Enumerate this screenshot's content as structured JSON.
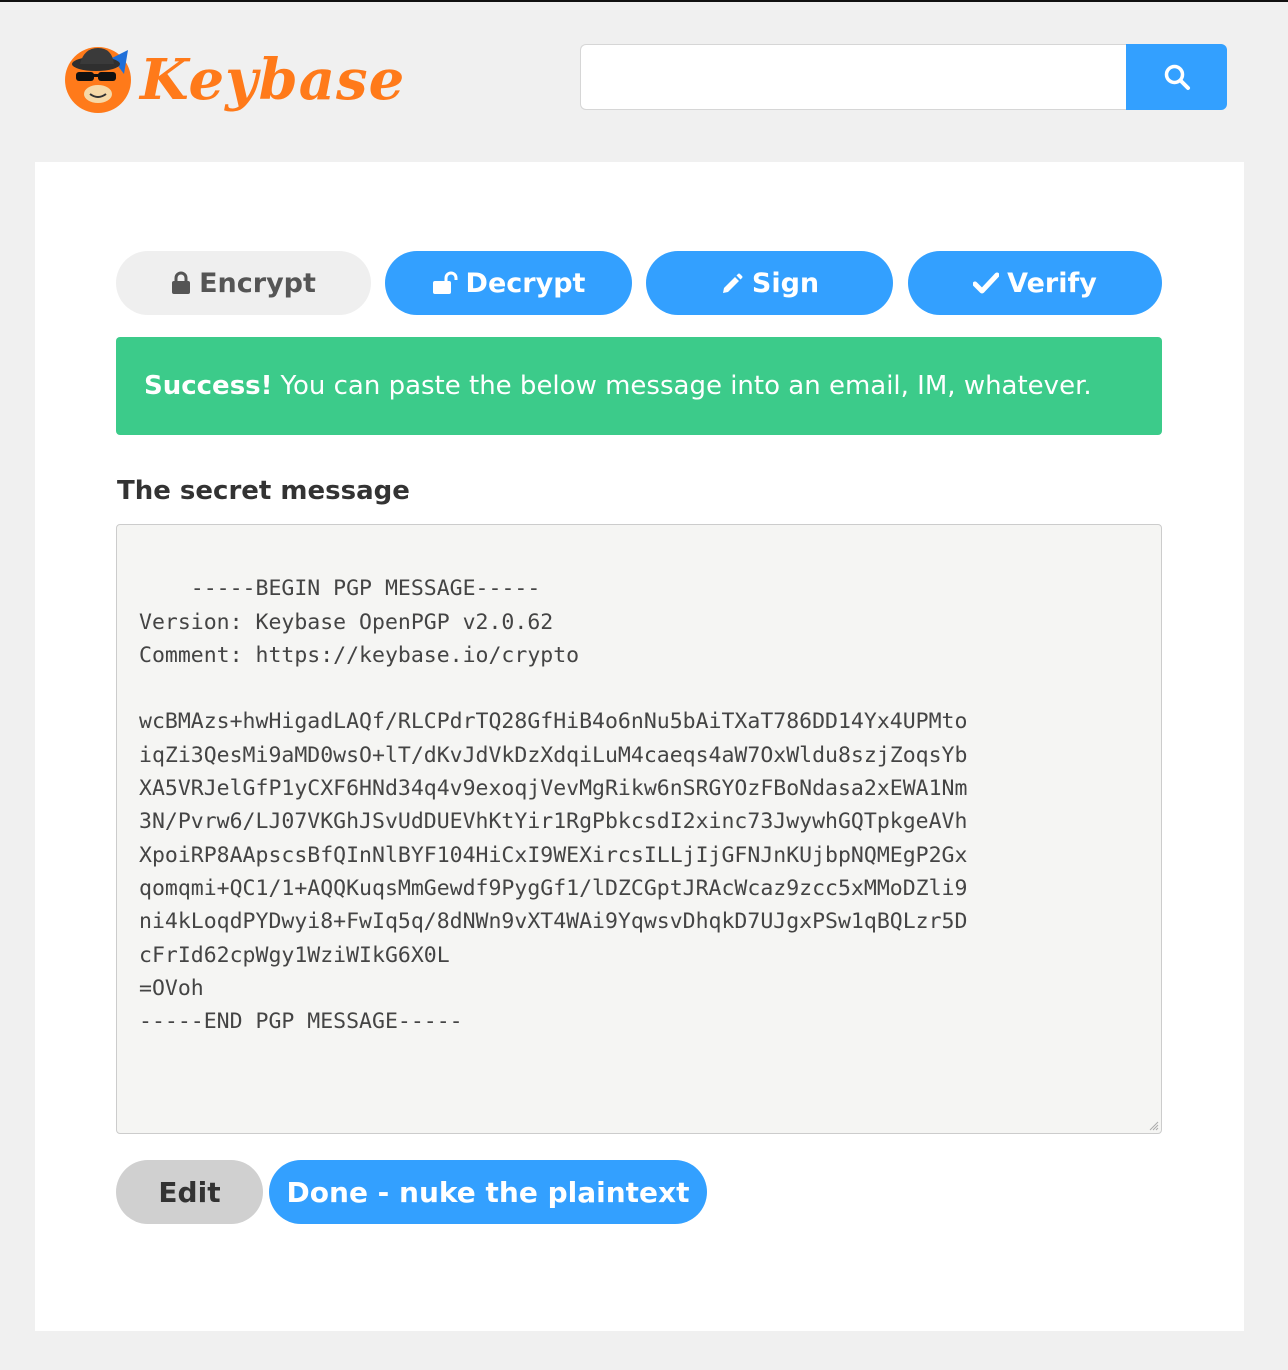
{
  "header": {
    "logo_text": "Keybase",
    "search": {
      "value": "",
      "placeholder": ""
    }
  },
  "tabs": [
    {
      "label": "Encrypt",
      "icon": "lock-icon",
      "state": "inactive"
    },
    {
      "label": "Decrypt",
      "icon": "unlock-icon",
      "state": "active"
    },
    {
      "label": "Sign",
      "icon": "pencil-icon",
      "state": "active"
    },
    {
      "label": "Verify",
      "icon": "checkmark-icon",
      "state": "active"
    }
  ],
  "alert": {
    "strong": "Success!",
    "text": "You can paste the below message into an email, IM, whatever."
  },
  "section_title": "The secret message",
  "pgp_message": "-----BEGIN PGP MESSAGE-----\nVersion: Keybase OpenPGP v2.0.62\nComment: https://keybase.io/crypto\n\nwcBMAzs+hwHigadLAQf/RLCPdrTQ28GfHiB4o6nNu5bAiTXaT786DD14Yx4UPMto\niqZi3QesMi9aMD0wsO+lT/dKvJdVkDzXdqiLuM4caeqs4aW7OxWldu8szjZoqsYb\nXA5VRJelGfP1yCXF6HNd34q4v9exoqjVevMgRikw6nSRGYOzFBoNdasa2xEWA1Nm\n3N/Pvrw6/LJ07VKGhJSvUdDUEVhKtYir1RgPbkcsdI2xinc73JwywhGQTpkgeAVh\nXpoiRP8AApscsBfQInNlBYF104HiCxI9WEXircsILLjIjGFNJnKUjbpNQMEgP2Gx\nqomqmi+QC1/1+AQQKuqsMmGewdf9PygGf1/lDZCGptJRAcWcaz9zcc5xMMoDZli9\nni4kLoqdPYDwyi8+FwIq5q/8dNWn9vXT4WAi9YqwsvDhqkD7UJgxPSw1qBQLzr5D\ncFrId62cpWgy1WziWIkG6X0L\n=OVoh\n-----END PGP MESSAGE-----",
  "actions": {
    "edit_label": "Edit",
    "done_label": "Done - nuke the plaintext"
  },
  "colors": {
    "primary": "#33a0ff",
    "success": "#3ccb8a",
    "brand_orange": "#ff7a1a"
  }
}
